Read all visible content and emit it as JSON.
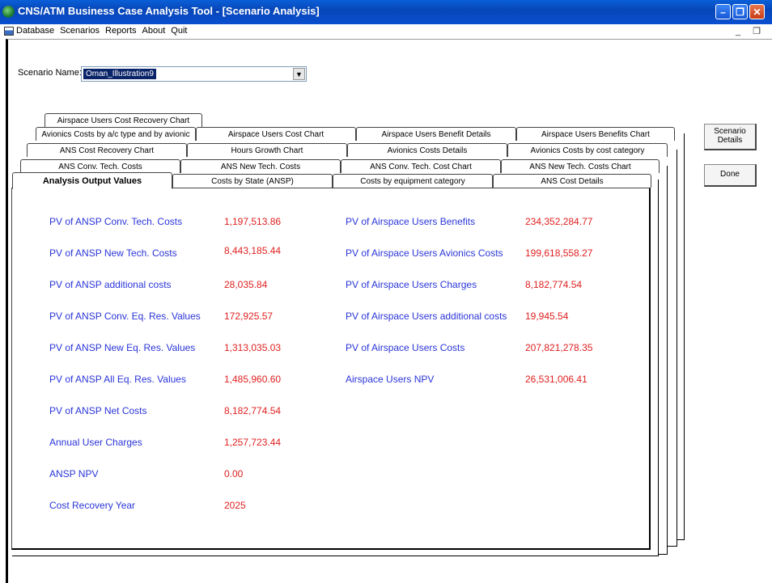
{
  "window": {
    "title": "CNS/ATM Business Case Analysis Tool - [Scenario Analysis]"
  },
  "menu": {
    "items": [
      "Database",
      "Scenarios",
      "Reports",
      "About",
      "Quit"
    ]
  },
  "scenario": {
    "label": "Scenario Name:",
    "value": "Oman_Illustration9"
  },
  "buttons": {
    "details": "Scenario Details",
    "done": "Done"
  },
  "tabs": {
    "row1": [
      "Airspace Users Cost Recovery Chart"
    ],
    "row2": [
      "Avionics Costs by a/c type and by avionic",
      "Airspace Users Cost Chart",
      "Airspace Users Benefit Details",
      "Airspace Users Benefits Chart"
    ],
    "row3": [
      "ANS Cost Recovery Chart",
      "Hours Growth Chart",
      "Avionics Costs Details",
      "Avionics Costs by cost category"
    ],
    "row4": [
      "ANS Conv. Tech. Costs",
      "ANS New Tech. Costs",
      "ANS Conv. Tech. Cost Chart",
      "ANS New Tech. Costs Chart"
    ],
    "row5": [
      "Analysis Output Values",
      "Costs by State (ANSP)",
      "Costs by equipment category",
      "ANS Cost Details"
    ]
  },
  "left_values": [
    {
      "label": "PV of ANSP Conv. Tech. Costs",
      "value": "1,197,513.86"
    },
    {
      "label": "PV of ANSP New Tech. Costs",
      "value": "8,443,185.44"
    },
    {
      "label": "PV of ANSP additional costs",
      "value": "28,035.84"
    },
    {
      "label": "PV of ANSP Conv. Eq. Res. Values",
      "value": "172,925.57"
    },
    {
      "label": "PV of ANSP New Eq. Res. Values",
      "value": "1,313,035.03"
    },
    {
      "label": "PV of ANSP All Eq. Res. Values",
      "value": "1,485,960.60"
    },
    {
      "label": "PV of ANSP Net Costs",
      "value": "8,182,774.54"
    },
    {
      "label": "Annual User Charges",
      "value": "1,257,723.44"
    },
    {
      "label": "ANSP NPV",
      "value": "0.00"
    },
    {
      "label": "Cost Recovery Year",
      "value": "2025"
    }
  ],
  "right_values": [
    {
      "label": "PV of Airspace Users Benefits",
      "value": "234,352,284.77"
    },
    {
      "label": "PV of Airspace Users Avionics Costs",
      "value": "199,618,558.27"
    },
    {
      "label": "PV of Airspace Users Charges",
      "value": "8,182,774.54"
    },
    {
      "label": "PV of Airspace Users additional costs",
      "value": "19,945.54"
    },
    {
      "label": "PV of Airspace Users Costs",
      "value": "207,821,278.35"
    },
    {
      "label": "Airspace Users NPV",
      "value": "26,531,006.41"
    }
  ]
}
